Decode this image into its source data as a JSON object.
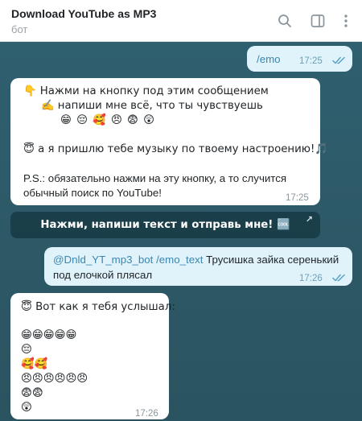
{
  "header": {
    "title": "Download YouTube as MP3",
    "subtitle": "бот",
    "icons": [
      "search-icon",
      "sidebar-toggle-icon",
      "more-vertical-icon"
    ]
  },
  "messages": [
    {
      "direction": "outgoing",
      "text": "/emo",
      "time": "17:25",
      "status": "read"
    },
    {
      "direction": "incoming",
      "lines": [
        "👇 Нажми на кнопку под этим сообщением",
        "✍️ напиши мне всё, что ты чувствуешь",
        "😁 😔 🥰 😠 😨 😲",
        "",
        "😇 а я пришлю тебе музыку по твоему настроению!🎵",
        "",
        "P.S.: обязательно нажми на эту кнопку, а то случится",
        "обычный поиск по YouTube!"
      ],
      "time": "17:25"
    },
    {
      "direction": "outgoing",
      "mention": "@Dnld_YT_mp3_bot /emo_text",
      "line1_rest": " Трусишка зайка серенький",
      "line2": "под елочкой плясал",
      "time": "17:26",
      "status": "read"
    },
    {
      "direction": "incoming",
      "lines": [
        "😇 Вот как я тебя услышал:",
        "",
        "😁😁😁😁😁",
        "😔",
        "🥰🥰",
        "😠😠😠😠😠😠",
        "😨😨",
        "😲"
      ],
      "time": "17:26"
    }
  ],
  "inline_button": {
    "label": "Нажми, напиши текст и отправь мне! 🆒",
    "arrow": "↗"
  },
  "colors": {
    "chat_background": "#2f5d6b",
    "outgoing_bubble": "#e0f3fb",
    "incoming_bubble": "#ffffff",
    "accent": "#3a86b0"
  }
}
